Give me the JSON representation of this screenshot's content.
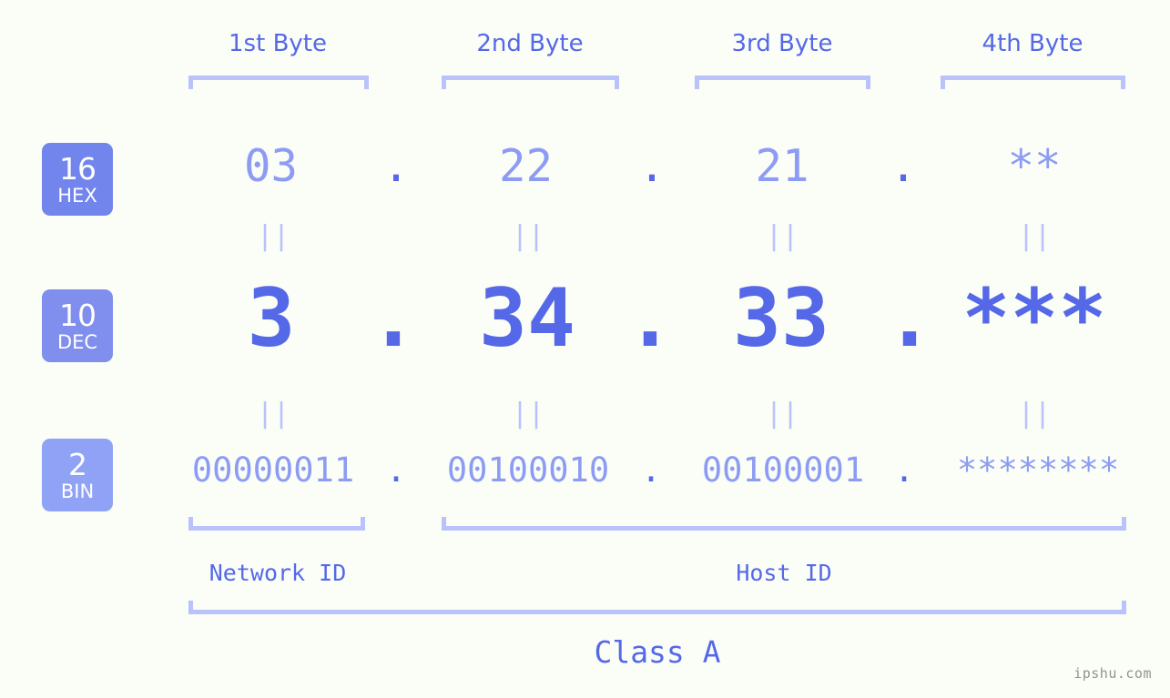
{
  "watermark": "ipshu.com",
  "headers": [
    {
      "label": "1st Byte"
    },
    {
      "label": "2nd Byte"
    },
    {
      "label": "3rd Byte"
    },
    {
      "label": "4th Byte"
    }
  ],
  "bases": [
    {
      "num": "16",
      "name": "HEX",
      "color": "#7285ec"
    },
    {
      "num": "10",
      "name": "DEC",
      "color": "#808eee"
    },
    {
      "num": "2",
      "name": "BIN",
      "color": "#8fa2f5"
    }
  ],
  "rows": {
    "hex": {
      "values": [
        "03",
        "22",
        "21",
        "**"
      ],
      "separator": "."
    },
    "dec": {
      "values": [
        "3",
        "34",
        "33",
        "***"
      ],
      "separator": "."
    },
    "bin": {
      "values": [
        "00000011",
        "00100010",
        "00100001",
        "********"
      ],
      "separator": "."
    }
  },
  "equals": "||",
  "sections": {
    "network": "Network ID",
    "host": "Host ID"
  },
  "class": "Class A",
  "chart_data": {
    "type": "table",
    "title": "IPv4 address byte breakdown",
    "ip_decimal": "3.34.33.***",
    "ip_hex": "03.22.21.**",
    "ip_binary": "00000011.00100010.00100001.********",
    "address_class": "Class A",
    "network_id_bytes": 1,
    "host_id_bytes": 3,
    "columns": [
      "1st Byte",
      "2nd Byte",
      "3rd Byte",
      "4th Byte"
    ],
    "series": [
      {
        "name": "HEX",
        "base": 16,
        "values": [
          "03",
          "22",
          "21",
          "**"
        ]
      },
      {
        "name": "DEC",
        "base": 10,
        "values": [
          "3",
          "34",
          "33",
          "***"
        ]
      },
      {
        "name": "BIN",
        "base": 2,
        "values": [
          "00000011",
          "00100010",
          "00100001",
          "********"
        ]
      }
    ]
  }
}
